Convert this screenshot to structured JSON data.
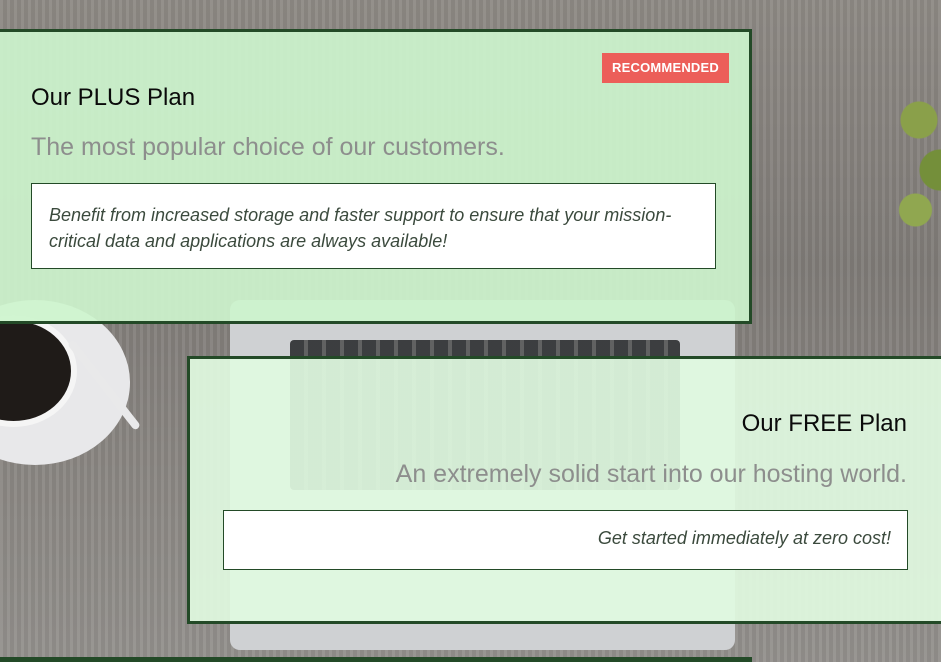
{
  "plans": {
    "plus": {
      "badge": "RECOMMENDED",
      "title": "Our PLUS Plan",
      "subtitle": "The most popular choice of our customers.",
      "description": "Benefit from increased storage and faster support to ensure that your mission-critical data and applications are always available!"
    },
    "free": {
      "title": "Our FREE Plan",
      "subtitle": "An extremely solid start into our hosting world.",
      "description": "Get started immediately at zero cost!"
    }
  },
  "colors": {
    "border": "#234a27",
    "badge": "#ec5e59",
    "plus_card_bg": "#cdf4cd",
    "free_card_bg": "#e1fae1",
    "subtitle": "#8d8e8d"
  }
}
